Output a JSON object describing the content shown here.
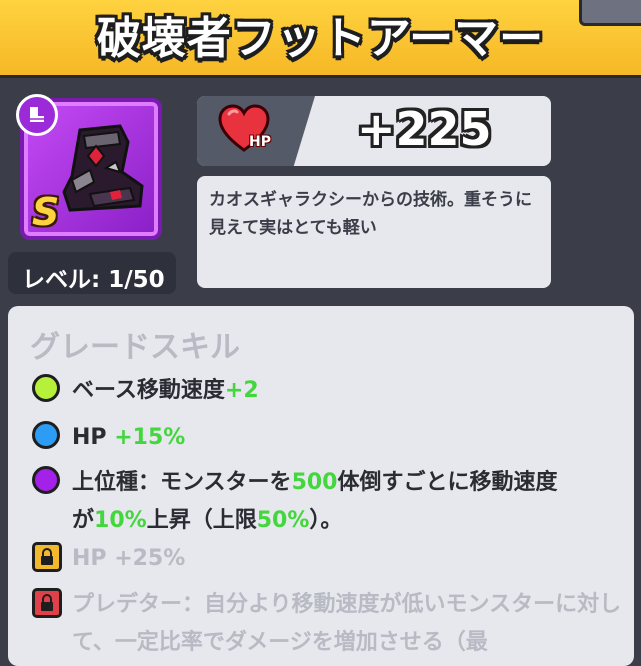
{
  "header": {
    "title": "破壊者フットアーマー"
  },
  "item": {
    "rank": "S",
    "level_label": "レベル: 1/50"
  },
  "stat": {
    "label": "HP",
    "value": "+225"
  },
  "description": "カオスギャラクシーからの技術。重そうに見えて実はとても軽い",
  "skills": {
    "title": "グレードスキル",
    "s1": {
      "text": "ベース移動速度",
      "value": "+2",
      "color": "#b7f03a"
    },
    "s2": {
      "label": "HP ",
      "value": "+15%",
      "color": "#2d9cf5"
    },
    "s3": {
      "a": "上位種：モンスターを",
      "b": "500",
      "c": "体倒すごとに移動速度",
      "d": "が",
      "e": "10%",
      "f": "上昇（上限",
      "g": "50%",
      "h": "）。",
      "color": "#a321e8"
    },
    "s4": {
      "text": "HP +25%",
      "lock_color": "#f3b92c"
    },
    "s5": {
      "text": "プレデター：自分より移動速度が低いモンスターに対して、一定比率でダメージを増加させる（最",
      "lock_color": "#e0404a"
    }
  }
}
